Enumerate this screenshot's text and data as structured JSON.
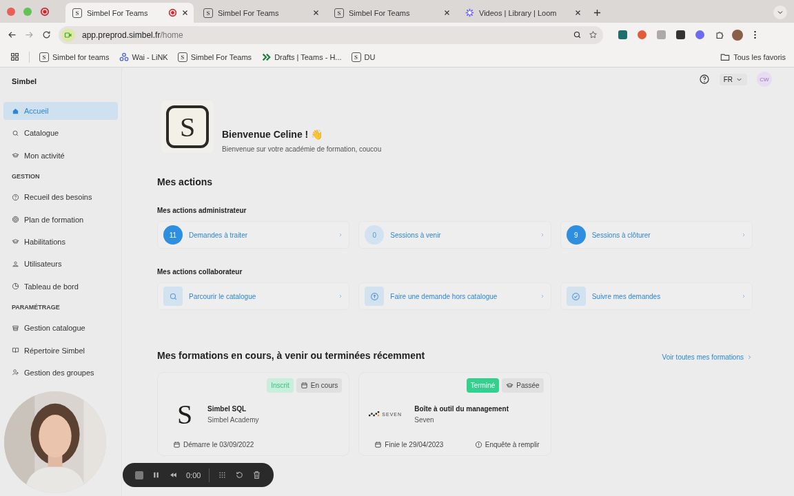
{
  "browser": {
    "tabs": [
      {
        "title": "Simbel For Teams",
        "kind": "letter",
        "favicon": "S",
        "selected": true,
        "recording": true
      },
      {
        "title": "Simbel For Teams",
        "kind": "letter",
        "favicon": "S",
        "selected": false,
        "recording": false
      },
      {
        "title": "Simbel For Teams",
        "kind": "letter",
        "favicon": "S",
        "selected": false,
        "recording": false
      },
      {
        "title": "Videos | Library | Loom",
        "kind": "starburst",
        "selected": false,
        "recording": false
      }
    ],
    "address": {
      "host": "app.preprod.simbel.fr",
      "path": "/home"
    },
    "bookmarks": [
      {
        "label": "Simbel for teams",
        "kind": "letter",
        "favicon": "S"
      },
      {
        "label": "Wai - LiNK",
        "kind": "people"
      },
      {
        "label": "Simbel For Teams",
        "kind": "letter",
        "favicon": "S"
      },
      {
        "label": "Drafts | Teams - H...",
        "kind": "drafts"
      },
      {
        "label": "DU",
        "kind": "letter",
        "favicon": "S"
      }
    ],
    "all_bookmarks": "Tous les favoris"
  },
  "sidebar": {
    "brand": "Simbel",
    "items": [
      {
        "kind": "item",
        "label": "Accueil",
        "selected": true
      },
      {
        "kind": "item",
        "label": "Catalogue",
        "selected": false
      },
      {
        "kind": "item",
        "label": "Mon activité",
        "selected": false
      },
      {
        "kind": "section",
        "label": "GESTION"
      },
      {
        "kind": "item",
        "label": "Recueil des besoins",
        "selected": false
      },
      {
        "kind": "item",
        "label": "Plan de formation",
        "selected": false
      },
      {
        "kind": "item",
        "label": "Habilitations",
        "selected": false
      },
      {
        "kind": "item",
        "label": "Utilisateurs",
        "selected": false
      },
      {
        "kind": "item",
        "label": "Tableau de bord",
        "selected": false
      },
      {
        "kind": "section",
        "label": "PARAMÉTRAGE"
      },
      {
        "kind": "item",
        "label": "Gestion catalogue",
        "selected": false
      },
      {
        "kind": "item",
        "label": "Répertoire Simbel",
        "selected": false
      },
      {
        "kind": "item",
        "label": "Gestion des groupes",
        "selected": false
      }
    ]
  },
  "header": {
    "language": "FR",
    "avatar": "CW"
  },
  "welcome": {
    "logo": "S",
    "title": "Bienvenue Celine ! 👋",
    "subtitle": "Bienvenue sur votre académie de formation, coucou"
  },
  "actions": {
    "heading": "Mes actions",
    "groups": [
      {
        "title": "Mes actions administrateur",
        "items": [
          {
            "kind": "count",
            "count": "11",
            "label": "Demandes à traiter",
            "filled": true
          },
          {
            "kind": "count",
            "count": "0",
            "label": "Sessions à venir",
            "filled": false
          },
          {
            "kind": "count",
            "count": "9",
            "label": "Sessions à clôturer",
            "filled": true
          }
        ]
      },
      {
        "title": "Mes actions collaborateur",
        "items": [
          {
            "kind": "icon",
            "label": "Parcourir le catalogue"
          },
          {
            "kind": "icon",
            "label": "Faire une demande hors catalogue"
          },
          {
            "kind": "icon",
            "label": "Suivre mes demandes"
          }
        ]
      }
    ]
  },
  "formations": {
    "heading": "Mes formations en cours, à venir ou terminées récemment",
    "link": "Voir toutes mes formations",
    "cards": [
      {
        "logo": {
          "kind": "letter",
          "text": "S"
        },
        "status": {
          "label": "Inscrit",
          "kind": "registered"
        },
        "tag": {
          "label": "En cours",
          "kind": "calendar"
        },
        "title": "Simbel SQL",
        "org": "Simbel Academy",
        "footer": [
          {
            "label": "Démarre le 03/09/2022",
            "kind": "calendar"
          }
        ]
      },
      {
        "logo": {
          "kind": "seven",
          "text": "SEVEN"
        },
        "status": {
          "label": "Terminé",
          "kind": "finished"
        },
        "tag": {
          "label": "Passée",
          "kind": "cap"
        },
        "title": "Boîte à outil du management",
        "org": "Seven",
        "footer": [
          {
            "label": "Finie le 29/04/2023",
            "kind": "calendar"
          },
          {
            "label": "Enquête à remplir",
            "kind": "info"
          }
        ]
      }
    ]
  },
  "recorder": {
    "time": "0:00"
  }
}
